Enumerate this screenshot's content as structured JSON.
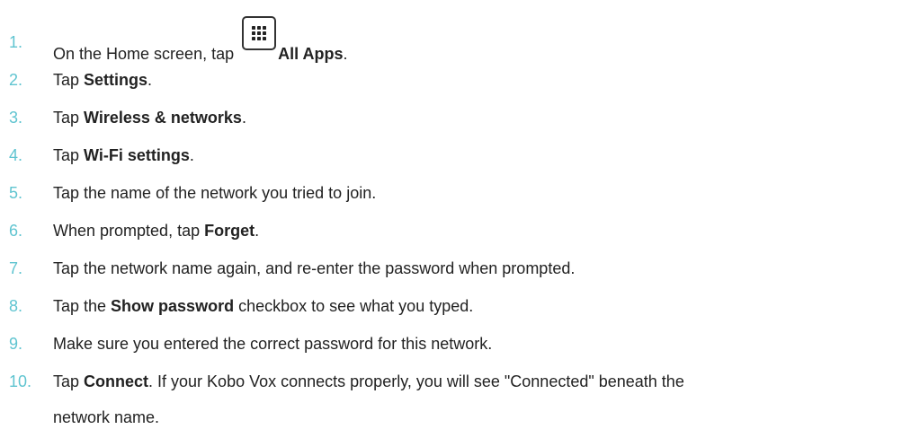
{
  "steps": [
    {
      "number": "1.",
      "before": "On the Home screen, tap",
      "icon": "all-apps-grid-icon",
      "bold": "All Apps",
      "after": "."
    },
    {
      "number": "2.",
      "before": "Tap ",
      "bold": "Settings",
      "after": "."
    },
    {
      "number": "3.",
      "before": "Tap ",
      "bold": "Wireless & networks",
      "after": "."
    },
    {
      "number": "4.",
      "before": "Tap ",
      "bold": "Wi-Fi settings",
      "after": "."
    },
    {
      "number": "5.",
      "text": "Tap the name of the network you tried to join."
    },
    {
      "number": "6.",
      "before": "When prompted, tap ",
      "bold": "Forget",
      "after": "."
    },
    {
      "number": "7.",
      "text": "Tap the network name again, and re-enter the password when prompted."
    },
    {
      "number": "8.",
      "before": "Tap the ",
      "bold": "Show password",
      "after": " checkbox to see what you typed."
    },
    {
      "number": "9.",
      "text": "Make sure you entered the correct password for this network."
    },
    {
      "number": "10.",
      "before": "Tap ",
      "bold": "Connect",
      "after": ". If your Kobo Vox connects properly, you will see \"Connected\" beneath the",
      "continuation": "network name."
    }
  ],
  "colors": {
    "number": "#5fc4d0",
    "text": "#222222"
  }
}
